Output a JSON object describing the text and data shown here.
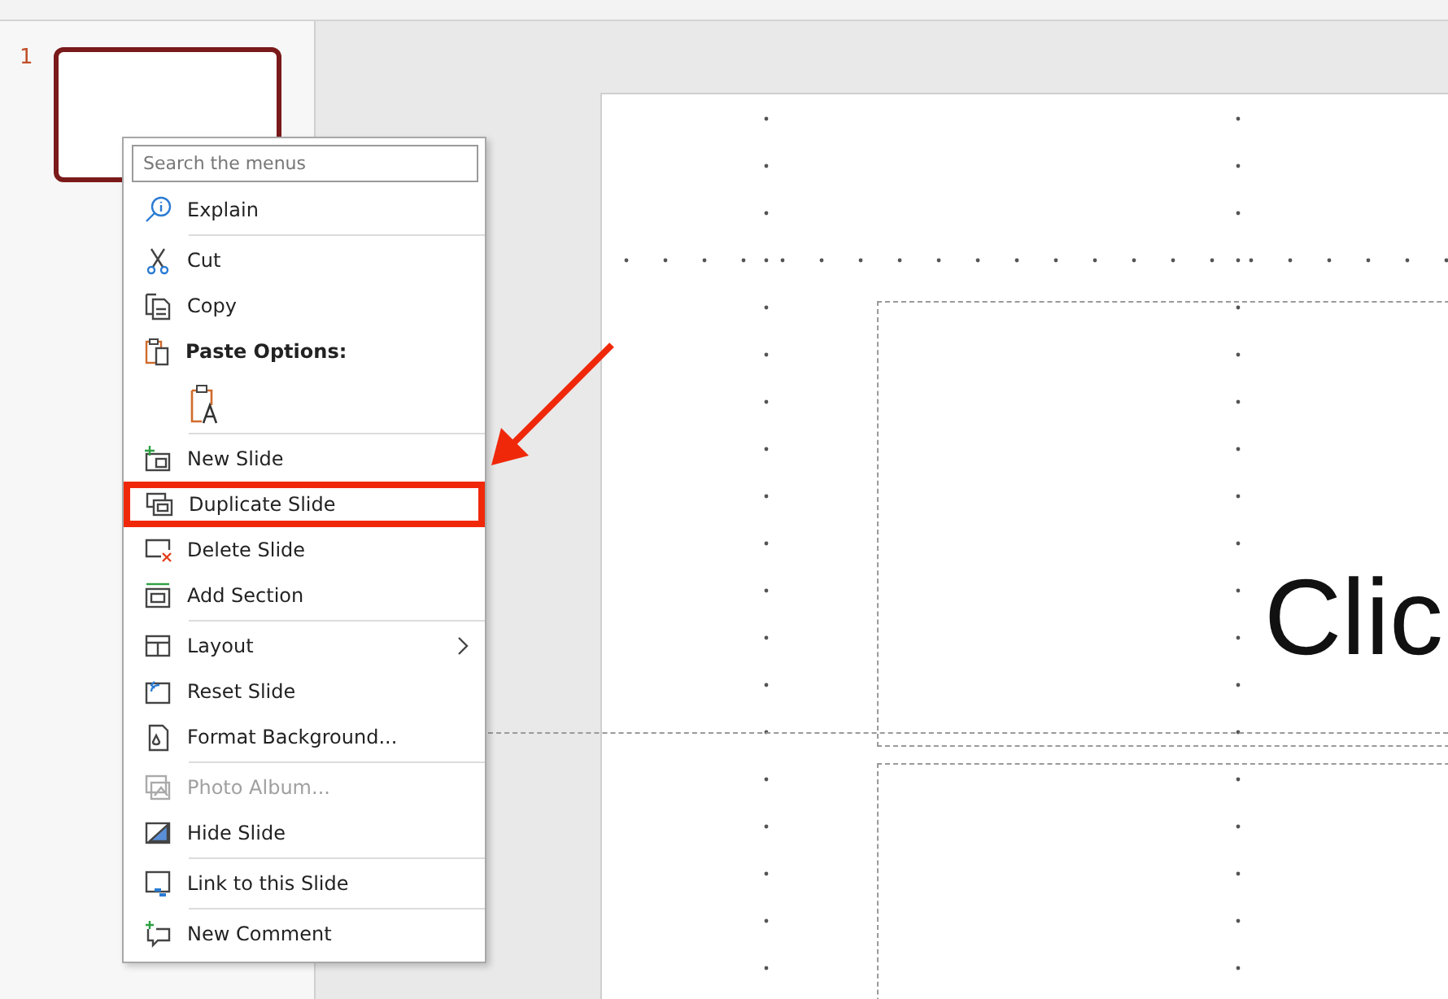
{
  "slide_panel": {
    "slide_number": "1"
  },
  "slide": {
    "title_placeholder": "Clic"
  },
  "context_menu": {
    "search": {
      "placeholder": "Search the menus"
    },
    "items": [
      {
        "kind": "item",
        "label": "Explain",
        "disabled": false,
        "submenu": false,
        "highlighted": false
      },
      {
        "kind": "separator"
      },
      {
        "kind": "item",
        "label": "Cut",
        "disabled": false,
        "submenu": false,
        "highlighted": false
      },
      {
        "kind": "item",
        "label": "Copy",
        "disabled": false,
        "submenu": false,
        "highlighted": false
      },
      {
        "kind": "header",
        "label": "Paste Options:"
      },
      {
        "kind": "paste-option"
      },
      {
        "kind": "separator"
      },
      {
        "kind": "item",
        "label": "New Slide",
        "disabled": false,
        "submenu": false,
        "highlighted": false
      },
      {
        "kind": "item",
        "label": "Duplicate Slide",
        "disabled": false,
        "submenu": false,
        "highlighted": true
      },
      {
        "kind": "item",
        "label": "Delete Slide",
        "disabled": false,
        "submenu": false,
        "highlighted": false
      },
      {
        "kind": "item",
        "label": "Add Section",
        "disabled": false,
        "submenu": false,
        "highlighted": false
      },
      {
        "kind": "separator"
      },
      {
        "kind": "item",
        "label": "Layout",
        "disabled": false,
        "submenu": true,
        "highlighted": false
      },
      {
        "kind": "item",
        "label": "Reset Slide",
        "disabled": false,
        "submenu": false,
        "highlighted": false
      },
      {
        "kind": "item",
        "label": "Format Background...",
        "disabled": false,
        "submenu": false,
        "highlighted": false
      },
      {
        "kind": "separator"
      },
      {
        "kind": "item",
        "label": "Photo Album...",
        "disabled": true,
        "submenu": false,
        "highlighted": false
      },
      {
        "kind": "item",
        "label": "Hide Slide",
        "disabled": false,
        "submenu": false,
        "highlighted": false
      },
      {
        "kind": "separator"
      },
      {
        "kind": "item",
        "label": "Link to this Slide",
        "disabled": false,
        "submenu": false,
        "highlighted": false
      },
      {
        "kind": "separator"
      },
      {
        "kind": "item",
        "label": "New Comment",
        "disabled": false,
        "submenu": false,
        "highlighted": false
      }
    ]
  }
}
